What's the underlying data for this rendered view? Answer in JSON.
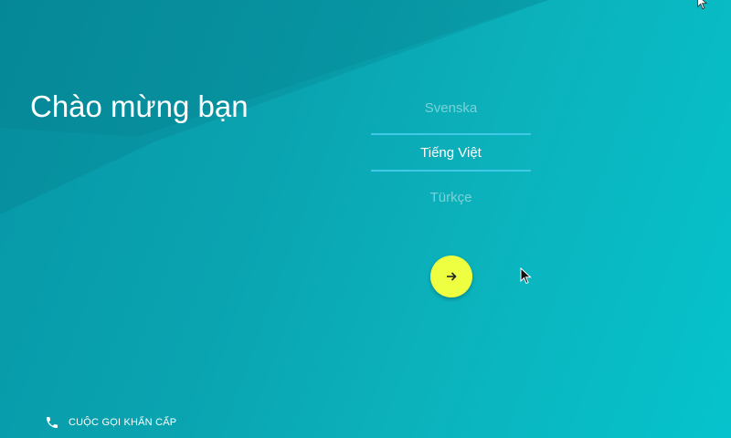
{
  "welcome": {
    "title": "Chào mừng bạn"
  },
  "language_picker": {
    "options": [
      "Svenska",
      "Tiếng Việt",
      "Türkçe"
    ],
    "selected": "Tiếng Việt"
  },
  "next_button": {
    "icon": "arrow-right-icon",
    "color": "#eeff41"
  },
  "emergency_call": {
    "label": "CUỘC GỌI KHẨN CẤP",
    "icon": "phone-icon"
  },
  "colors": {
    "background_start": "#0797a7",
    "background_end": "#05c3cc",
    "divider": "#3fc9e6",
    "accent": "#eeff41"
  }
}
